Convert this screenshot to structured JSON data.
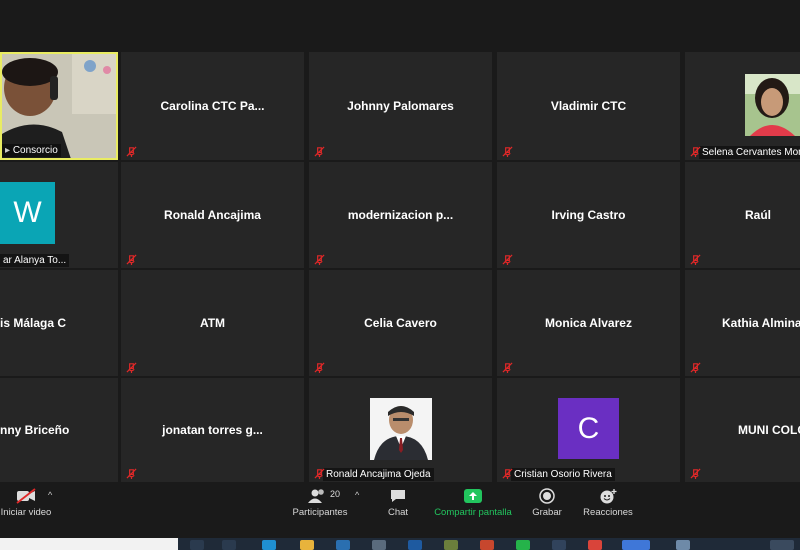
{
  "colors": {
    "tile_bg": "#262626",
    "active_border": "#e9ec62",
    "mute_red": "#e02828",
    "avatar_teal": "#0aa5b5",
    "avatar_purple": "#6a2fc2",
    "share_green": "#22c55e"
  },
  "tiles": [
    {
      "name": "Consorcio",
      "type": "video-self"
    },
    {
      "name": "Carolina CTC Pa..."
    },
    {
      "name": "Johnny Palomares"
    },
    {
      "name": "Vladimir CTC"
    },
    {
      "name": "Selena Cervantes Mon",
      "type": "photo"
    },
    {
      "name": "ar Alanya To...",
      "type": "avatar",
      "letter": "W"
    },
    {
      "name": "Ronald Ancajima"
    },
    {
      "name": "modernizacion p..."
    },
    {
      "name": "Irving Castro"
    },
    {
      "name": "Raúl"
    },
    {
      "name": "is Málaga C"
    },
    {
      "name": "ATM"
    },
    {
      "name": "Celia Cavero"
    },
    {
      "name": "Monica Alvarez"
    },
    {
      "name": "Kathia  Almina"
    },
    {
      "name": "nny Briceño"
    },
    {
      "name": "jonatan torres g..."
    },
    {
      "name": "Ronald Ancajima Ojeda",
      "type": "photo"
    },
    {
      "name": "Cristian Osorio Rivera",
      "type": "avatar",
      "letter": "C"
    },
    {
      "name": "MUNI COLC"
    }
  ],
  "toolbar": {
    "video_label": "Iniciar video",
    "participants_label": "Participantes",
    "participants_count": "20",
    "chat_label": "Chat",
    "share_label": "Compartir pantalla",
    "record_label": "Grabar",
    "reactions_label": "Reacciones"
  }
}
